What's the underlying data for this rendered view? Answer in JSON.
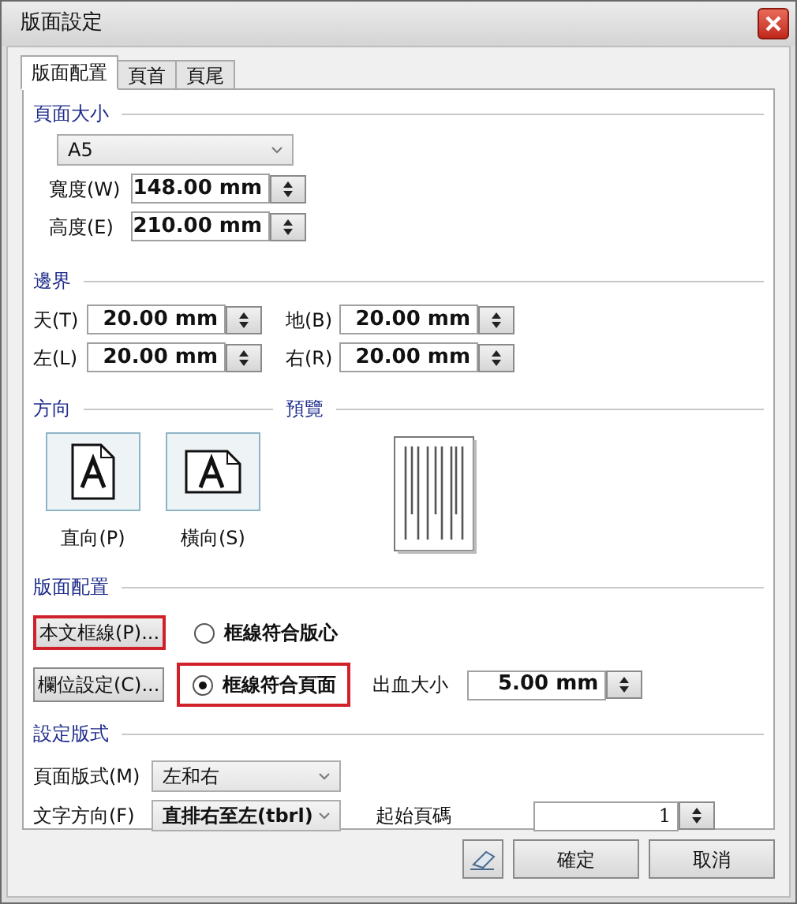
{
  "window": {
    "title": "版面設定"
  },
  "tabs": [
    {
      "label": "版面配置",
      "selected": true
    },
    {
      "label": "頁首",
      "selected": false
    },
    {
      "label": "頁尾",
      "selected": false
    }
  ],
  "page_size": {
    "heading": "頁面大小",
    "paper": "A5",
    "fields": [
      {
        "label": "寬度(W)",
        "value": "148.00 mm"
      },
      {
        "label": "高度(E)",
        "value": "210.00 mm"
      }
    ]
  },
  "margins": {
    "heading": "邊界",
    "fields": [
      {
        "label": "天(T)",
        "value": "20.00 mm"
      },
      {
        "label": "地(B)",
        "value": "20.00 mm"
      },
      {
        "label": "左(L)",
        "value": "20.00 mm"
      },
      {
        "label": "右(R)",
        "value": "20.00 mm"
      }
    ]
  },
  "orientation": {
    "heading": "方向",
    "options": [
      {
        "label": "直向(P)",
        "kind": "portrait"
      },
      {
        "label": "橫向(S)",
        "kind": "landscape"
      }
    ]
  },
  "preview": {
    "heading": "預覽"
  },
  "layout": {
    "heading": "版面配置",
    "buttons": [
      {
        "label": "本文框線(P)...",
        "highlighted": true
      },
      {
        "label": "欄位設定(C)...",
        "highlighted": false
      }
    ],
    "radios": [
      {
        "label": "框線符合版心",
        "selected": false,
        "highlighted": false
      },
      {
        "label": "框線符合頁面",
        "selected": true,
        "highlighted": true
      }
    ],
    "bleed": {
      "label": "出血大小",
      "value": "5.00 mm"
    }
  },
  "format": {
    "heading": "設定版式",
    "page_style": {
      "label": "頁面版式(M)",
      "value": "左和右"
    },
    "text_direction": {
      "label": "文字方向(F)",
      "value": "直排右至左(tbrl)"
    },
    "start_page": {
      "label": "起始頁碼",
      "value": "1"
    }
  },
  "buttons": [
    {
      "label": "確定"
    },
    {
      "label": "取消"
    }
  ]
}
